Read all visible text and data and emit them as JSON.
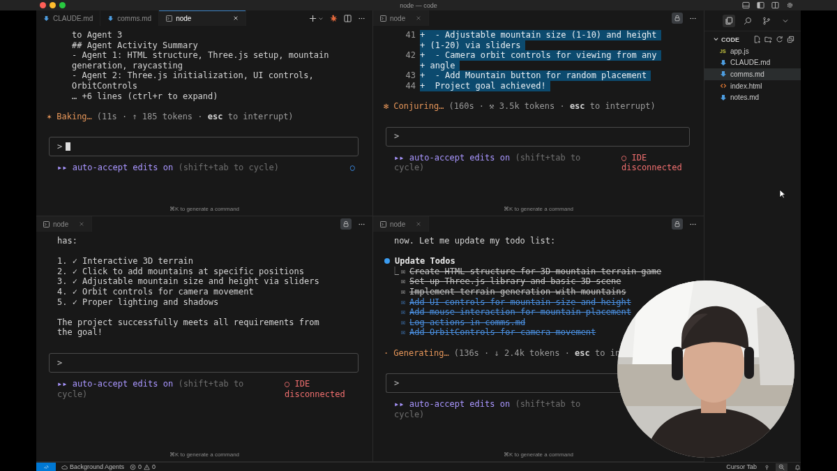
{
  "window": {
    "title": "node — code"
  },
  "panes": [
    {
      "focused": true,
      "tabs": [
        {
          "label": "CLAUDE.md",
          "kind": "markdown",
          "selected": false
        },
        {
          "label": "comms.md",
          "kind": "markdown",
          "selected": false
        },
        {
          "label": "node",
          "kind": "terminal",
          "selected": true
        }
      ],
      "actions": [
        {
          "kind": "new-terminal"
        },
        {
          "kind": "agent"
        },
        {
          "kind": "split"
        },
        {
          "kind": "more"
        }
      ],
      "blocks": [
        {
          "kind": "result",
          "lines": [
            "to Agent 3",
            "## Agent Activity Summary",
            "- Agent 1: HTML structure, Three.js setup, mountain",
            "generation, raycasting",
            "- Agent 2: Three.js initialization, UI controls,",
            "OrbitControls",
            "… +6 lines (ctrl+r to expand)"
          ]
        }
      ],
      "status": {
        "icon": "✶",
        "verb": "Baking…",
        "detail": "(11s · ↑ 185 tokens · **esc** to interrupt)"
      },
      "prompt": {
        "symbol": ">",
        "cursor": true
      },
      "mode": {
        "symbol": "▸▸",
        "label": "auto-accept edits on",
        "hint": "(shift+tab to cycle)"
      },
      "ide": {
        "symbol": "○",
        "connected": true
      },
      "footer": "⌘K to generate a command"
    },
    {
      "focused": false,
      "tabs": [
        {
          "label": "node",
          "kind": "terminal",
          "selected": true
        }
      ],
      "actions": [
        {
          "kind": "lock",
          "on": true
        },
        {
          "kind": "more"
        }
      ],
      "blocks": [
        {
          "kind": "diff",
          "rows": [
            {
              "number": "41",
              "text": "+  - Adjustable mountain size (1-10) and height"
            },
            {
              "text": "+ (1-20) via sliders"
            },
            {
              "number": "42",
              "text": "+  - Camera orbit controls for viewing from any"
            },
            {
              "text": "+ angle"
            },
            {
              "number": "43",
              "text": "+  - Add Mountain button for random placement"
            },
            {
              "number": "44",
              "text": "+  Project goal achieved!"
            }
          ]
        }
      ],
      "status": {
        "icon": "✻",
        "verb": "Conjuring…",
        "detail": "(160s · ⚒ 3.5k tokens · **esc** to interrupt)"
      },
      "prompt": {
        "symbol": ">"
      },
      "mode": {
        "symbol": "▸▸",
        "label": "auto-accept edits on",
        "hint": "(shift+tab to cycle)"
      },
      "ide": {
        "symbol": "○",
        "text": "IDE disconnected",
        "connected": false
      },
      "footer": "⌘K to generate a command"
    },
    {
      "focused": false,
      "tabs": [
        {
          "label": "node",
          "kind": "terminal",
          "selected": true
        }
      ],
      "actions": [
        {
          "kind": "lock",
          "on": true
        },
        {
          "kind": "more"
        }
      ],
      "blocks": [
        {
          "kind": "message",
          "lines": [
            "has:"
          ]
        },
        {
          "kind": "message",
          "lines": [
            "1. ✓ Interactive 3D terrain",
            "2. ✓ Click to add mountains at specific positions",
            "3. ✓ Adjustable mountain size and height via sliders",
            "4. ✓ Orbit controls for camera movement",
            "5. ✓ Proper lighting and shadows"
          ]
        },
        {
          "kind": "message",
          "lines": [
            "The project successfully meets all requirements from",
            "the goal!"
          ]
        }
      ],
      "prompt": {
        "symbol": ">"
      },
      "mode": {
        "symbol": "▸▸",
        "label": "auto-accept edits on",
        "hint": "(shift+tab to cycle)"
      },
      "ide": {
        "symbol": "○",
        "text": "IDE disconnected",
        "connected": false
      },
      "footer": "⌘K to generate a command"
    },
    {
      "focused": false,
      "tabs": [
        {
          "label": "node",
          "kind": "terminal",
          "selected": true
        }
      ],
      "actions": [
        {
          "kind": "lock",
          "on": true
        },
        {
          "kind": "more"
        }
      ],
      "blocks": [
        {
          "kind": "message",
          "lines": [
            "now. Let me update my todo list:"
          ]
        },
        {
          "kind": "todos",
          "title": "Update Todos",
          "connector": "⎿",
          "items": [
            {
              "box": "☒",
              "text": "Create HTML structure for 3D mountain terrain game",
              "done": true,
              "just_completed": false
            },
            {
              "box": "☒",
              "text": "Set up Three.js library and basic 3D scene",
              "done": true,
              "just_completed": false
            },
            {
              "box": "☒",
              "text": "Implement terrain generation with mountains",
              "done": true,
              "just_completed": false
            },
            {
              "box": "☒",
              "text": "Add UI controls for mountain size and height",
              "done": true,
              "just_completed": true
            },
            {
              "box": "☒",
              "text": "Add mouse interaction for mountain placement",
              "done": true,
              "just_completed": true
            },
            {
              "box": "☒",
              "text": "Log actions in comms.md",
              "done": true,
              "just_completed": true
            },
            {
              "box": "☒",
              "text": "Add OrbitControls for camera movement",
              "done": true,
              "just_completed": true
            }
          ]
        }
      ],
      "status": {
        "icon": "·",
        "verb": "Generating…",
        "detail": "(136s · ↓ 2.4k tokens · **esc** to in"
      },
      "prompt": {
        "symbol": ">"
      },
      "mode": {
        "symbol": "▸▸",
        "label": "auto-accept edits on",
        "hint": "(shift+tab to cycle)"
      },
      "footer": "⌘K to generate a command"
    }
  ],
  "sidebar": {
    "activity": [
      {
        "kind": "files",
        "selected": true
      },
      {
        "kind": "search",
        "selected": false
      },
      {
        "kind": "source-control",
        "selected": false
      },
      {
        "kind": "chevron",
        "selected": false
      }
    ],
    "folder": {
      "name": "CODE",
      "expanded": true
    },
    "files": [
      {
        "name": "app.js",
        "kind": "js",
        "badge": "JS",
        "selected": false
      },
      {
        "name": "CLAUDE.md",
        "kind": "markdown",
        "selected": false
      },
      {
        "name": "comms.md",
        "kind": "markdown",
        "selected": true
      },
      {
        "name": "index.html",
        "kind": "html",
        "selected": false
      },
      {
        "name": "notes.md",
        "kind": "markdown",
        "selected": false
      }
    ]
  },
  "status_bar": {
    "agents": "Background Agents",
    "errors": "0",
    "warnings": "0",
    "right": "Cursor Tab"
  }
}
